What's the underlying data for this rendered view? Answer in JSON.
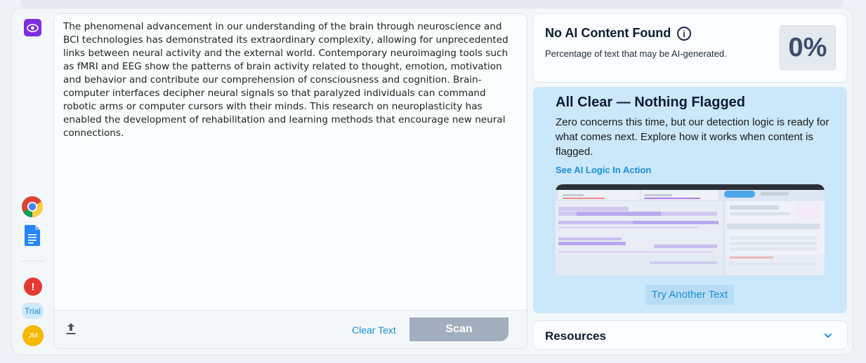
{
  "editor": {
    "text": "The phenomenal advancement in our understanding of the brain through neuroscience and BCI technologies has demonstrated its extraordinary complexity, allowing for unprecedented links between neural activity and the external world. Contemporary neuroimaging tools such as fMRI and EEG show the patterns of brain activity related to thought, emotion, motivation and behavior and contribute our comprehension of consciousness and cognition. Brain-computer interfaces decipher neural signals so that paralyzed individuals can command robotic arms or computer cursors with their minds. This research on neuroplasticity has enabled the development of rehabilitation and learning methods that encourage new neural connections.",
    "clear_label": "Clear Text",
    "scan_label": "Scan"
  },
  "sidebar": {
    "trial_label": "Trial",
    "avatar_initials": "JM",
    "alert_glyph": "!"
  },
  "result": {
    "title": "No AI Content Found",
    "subtitle": "Percentage of text that may be AI-generated.",
    "score": "0%"
  },
  "all_clear": {
    "title": "All Clear — Nothing Flagged",
    "body": "Zero concerns this time, but our detection logic is ready for what comes next. Explore how it works when content is flagged.",
    "link_label": "See AI Logic In Action",
    "try_label": "Try Another Text"
  },
  "resources": {
    "title": "Resources"
  },
  "colors": {
    "accent": "#1a8fd8",
    "brand_purple": "#7c2ee0",
    "panel_blue": "#cbe7fa",
    "scan_disabled": "#a2aebe"
  },
  "icons": [
    "eye-icon",
    "chrome-icon",
    "document-icon",
    "alert-icon",
    "upload-icon",
    "info-icon",
    "chevron-down-icon"
  ]
}
